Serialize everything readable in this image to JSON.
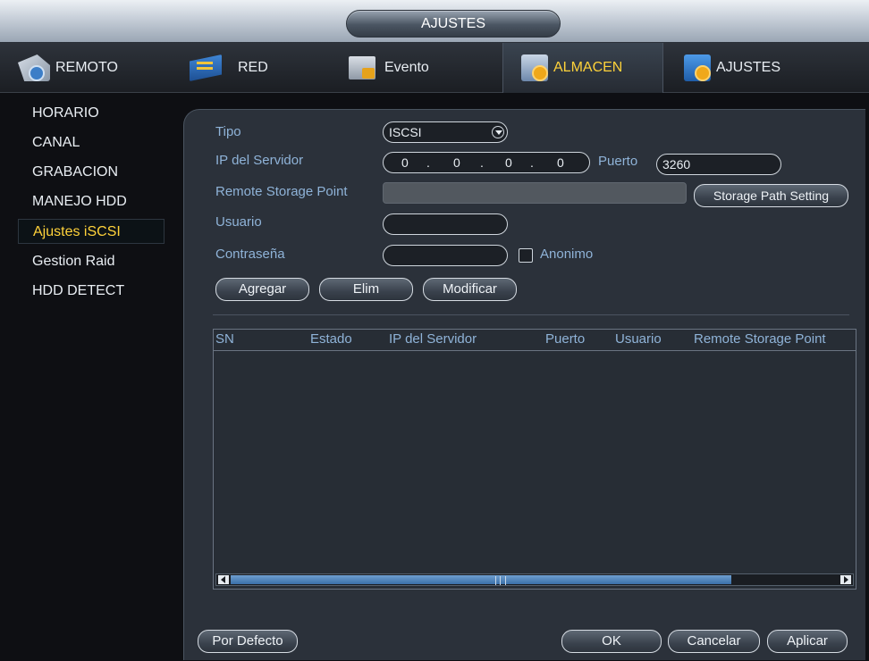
{
  "window": {
    "title": "AJUSTES"
  },
  "tabs": [
    {
      "label": "REMOTO",
      "icon": "remote-camera-icon",
      "active": false
    },
    {
      "label": "RED",
      "icon": "network-icon",
      "active": false
    },
    {
      "label": "Evento",
      "icon": "event-icon",
      "active": false
    },
    {
      "label": "ALMACEN",
      "icon": "storage-icon",
      "active": true
    },
    {
      "label": "AJUSTES",
      "icon": "settings-icon",
      "active": false
    }
  ],
  "sidebar": {
    "items": [
      {
        "label": "HORARIO",
        "selected": false
      },
      {
        "label": "CANAL",
        "selected": false
      },
      {
        "label": "GRABACION",
        "selected": false
      },
      {
        "label": "MANEJO HDD",
        "selected": false
      },
      {
        "label": "Ajustes iSCSI",
        "selected": true
      },
      {
        "label": "Gestion Raid",
        "selected": false
      },
      {
        "label": "HDD DETECT",
        "selected": false
      }
    ]
  },
  "form": {
    "tipo_label": "Tipo",
    "tipo_value": "ISCSI",
    "ip_label": "IP del Servidor",
    "ip_octets": [
      "0",
      "0",
      "0",
      "0"
    ],
    "ip_sep": ".",
    "puerto_label": "Puerto",
    "puerto_value": "3260",
    "remote_label": "Remote Storage Point",
    "remote_value": "",
    "storage_path_button": "Storage Path Setting",
    "usuario_label": "Usuario",
    "usuario_value": "",
    "contrasena_label": "Contraseña",
    "contrasena_value": "",
    "anonimo_label": "Anonimo",
    "anonimo_checked": false
  },
  "actions": {
    "agregar": "Agregar",
    "elim": "Elim",
    "modificar": "Modificar"
  },
  "table": {
    "columns": [
      "SN",
      "Estado",
      "IP del Servidor",
      "Puerto",
      "Usuario",
      "Remote Storage Point"
    ],
    "rows": []
  },
  "footer": {
    "por_defecto": "Por Defecto",
    "ok": "OK",
    "cancelar": "Cancelar",
    "aplicar": "Aplicar"
  },
  "colors": {
    "accent_selected": "#ffd23a",
    "label_blue": "#8fb3d8",
    "panel_bg": "#2b313a"
  }
}
